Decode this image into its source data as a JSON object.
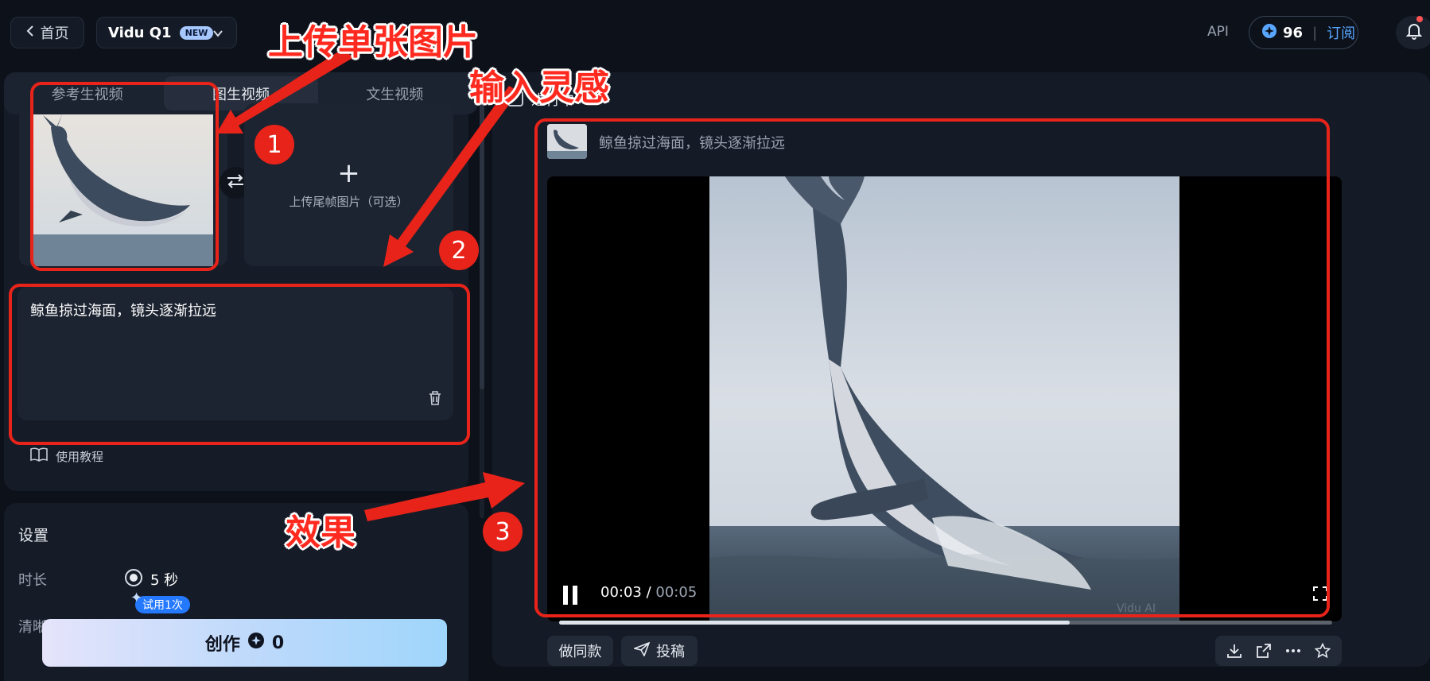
{
  "header": {
    "home_label": "首页",
    "model_name": "Vidu Q1",
    "model_badge": "NEW",
    "api_label": "API",
    "credits": "96",
    "subscribe_label": "订阅"
  },
  "tabs": [
    {
      "label": "参考生视频",
      "active": false
    },
    {
      "label": "图生视频",
      "active": true
    },
    {
      "label": "文生视频",
      "active": false
    }
  ],
  "upload": {
    "last_frame_label": "上传尾帧图片（可选）"
  },
  "prompt": {
    "text": "鲸鱼掠过海面，镜头逐渐拉远"
  },
  "tutorial_label": "使用教程",
  "settings": {
    "title": "设置",
    "duration_label": "时长",
    "duration_value": "5 秒",
    "trial_badge": "试用1次",
    "resolution_label": "清晰度"
  },
  "create_button": {
    "label": "创作",
    "cost": "0"
  },
  "result": {
    "status_label": "进行中",
    "prompt": "鲸鱼掠过海面，镜头逐渐拉远",
    "time_current": "00:03",
    "time_total": "00:05",
    "progress": 0.66,
    "watermark": "Vidu AI",
    "same_style_label": "做同款",
    "submit_label": "投稿"
  },
  "annotations": {
    "label_upload": "上传单张图片",
    "label_input": "输入灵感",
    "label_effect": "效果",
    "step1": "1",
    "step2": "2",
    "step3": "3"
  },
  "colors": {
    "background": "#0c111a",
    "panel": "#161c27",
    "accent_blue": "#58a6ff",
    "annotation_red": "#e8231a"
  }
}
